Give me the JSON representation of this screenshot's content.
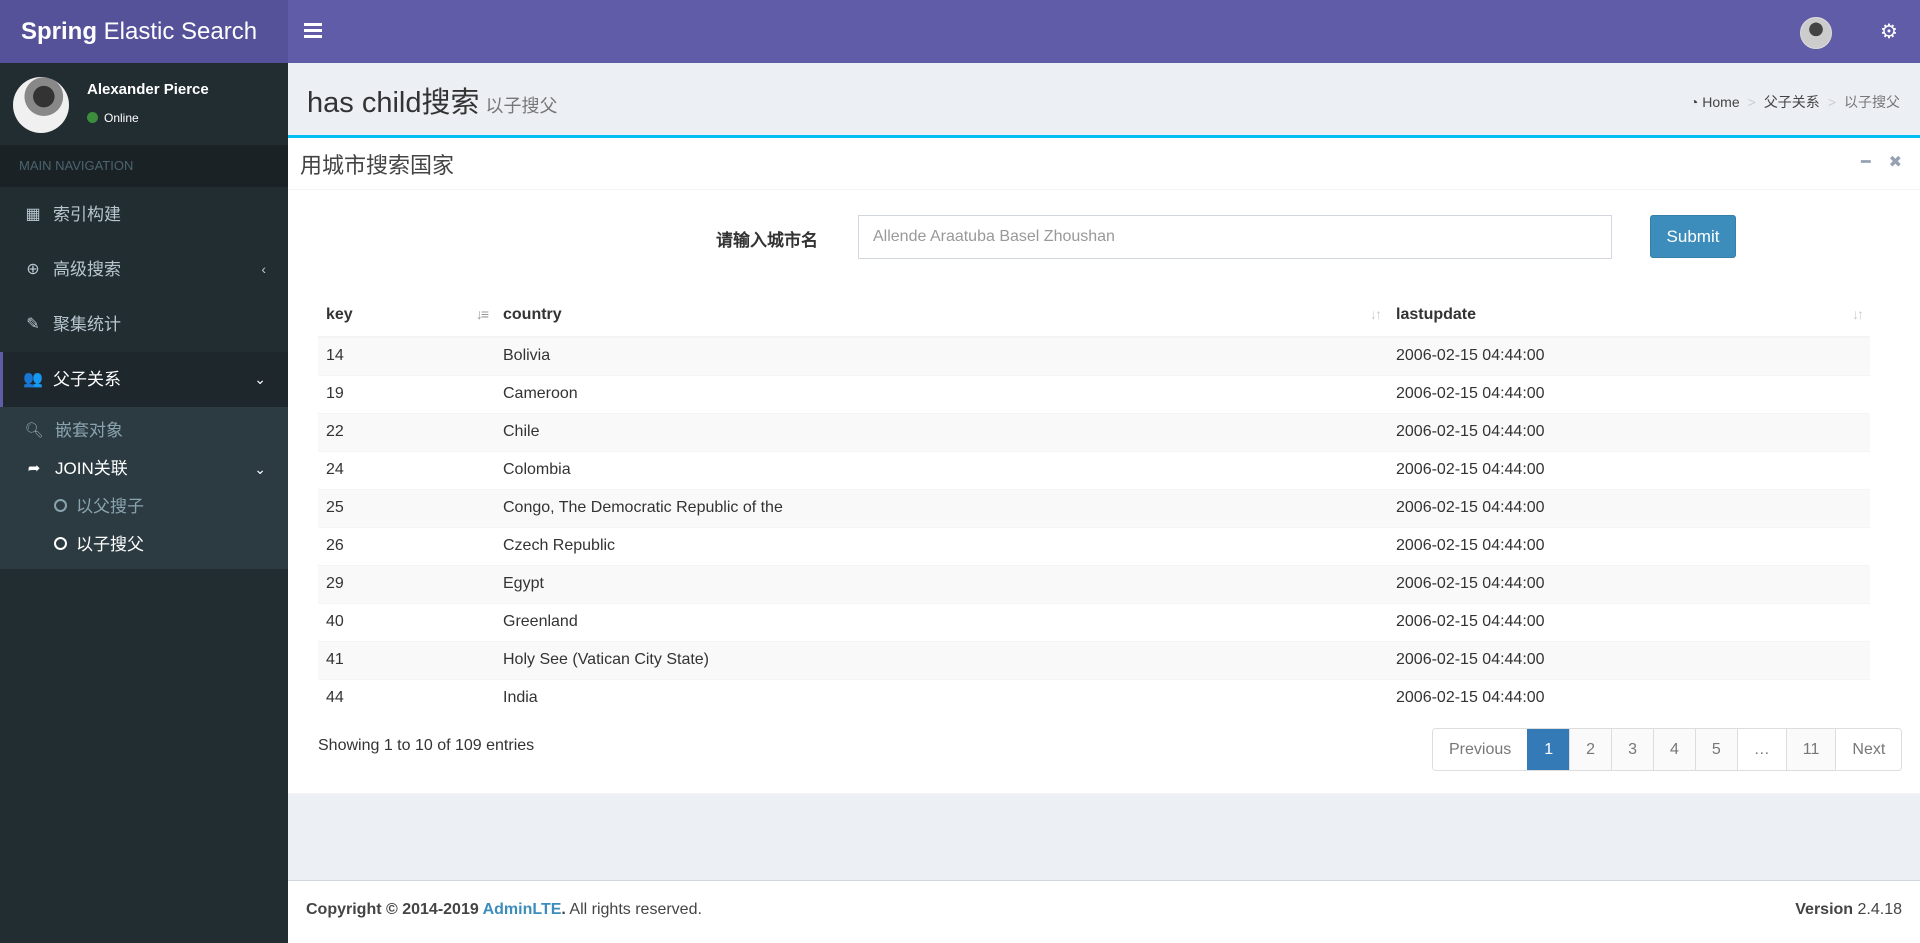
{
  "topbar": {
    "logo_bold": "Spring",
    "logo_rest": " Elastic Search",
    "menu_icon": "hamburger-icon",
    "settings_icon": "gears-icon"
  },
  "sidebar": {
    "user": {
      "name": "Alexander Pierce",
      "status": "Online",
      "status_color": "#3c8d3c"
    },
    "nav_header": "MAIN NAVIGATION",
    "items": [
      {
        "label": "索引构建",
        "icon": "calendar-icon"
      },
      {
        "label": "高级搜索",
        "icon": "search-plus-icon",
        "chevron": "‹"
      },
      {
        "label": "聚集统计",
        "icon": "edit-icon"
      },
      {
        "label": "父子关系",
        "icon": "users-icon",
        "chevron": "⌄",
        "active": true
      }
    ],
    "submenu": [
      {
        "label": "嵌套对象",
        "icon": "search-icon"
      },
      {
        "label": "JOIN关联",
        "icon": "share-icon",
        "chevron": "⌄"
      }
    ],
    "submenu2": [
      {
        "label": "以父搜子",
        "icon": "circle-icon"
      },
      {
        "label": "以子搜父",
        "icon": "circle-icon",
        "active": true
      }
    ]
  },
  "content_header": {
    "title": "has child搜索",
    "subtitle": "以子搜父",
    "breadcrumb": [
      "Home",
      "父子关系",
      "以子搜父"
    ]
  },
  "box": {
    "title": "用城市搜索国家",
    "label": "请输入城市名",
    "input_placeholder": "Allende Araatuba Basel Zhoushan",
    "input_value": "",
    "submit_label": "Submit",
    "accent": "#00c0ef"
  },
  "table": {
    "columns": [
      "key",
      "country",
      "lastupdate"
    ],
    "rows": [
      {
        "key": "14",
        "country": "Bolivia",
        "lastupdate": "2006-02-15 04:44:00"
      },
      {
        "key": "19",
        "country": "Cameroon",
        "lastupdate": "2006-02-15 04:44:00"
      },
      {
        "key": "22",
        "country": "Chile",
        "lastupdate": "2006-02-15 04:44:00"
      },
      {
        "key": "24",
        "country": "Colombia",
        "lastupdate": "2006-02-15 04:44:00"
      },
      {
        "key": "25",
        "country": "Congo, The Democratic Republic of the",
        "lastupdate": "2006-02-15 04:44:00"
      },
      {
        "key": "26",
        "country": "Czech Republic",
        "lastupdate": "2006-02-15 04:44:00"
      },
      {
        "key": "29",
        "country": "Egypt",
        "lastupdate": "2006-02-15 04:44:00"
      },
      {
        "key": "40",
        "country": "Greenland",
        "lastupdate": "2006-02-15 04:44:00"
      },
      {
        "key": "41",
        "country": "Holy See (Vatican City State)",
        "lastupdate": "2006-02-15 04:44:00"
      },
      {
        "key": "44",
        "country": "India",
        "lastupdate": "2006-02-15 04:44:00"
      }
    ],
    "info": "Showing 1 to 10 of 109 entries",
    "pagination": {
      "previous": "Previous",
      "pages": [
        "1",
        "2",
        "3",
        "4",
        "5",
        "…",
        "11"
      ],
      "current": "1",
      "next": "Next"
    }
  },
  "footer": {
    "copyright_bold": "Copyright © 2014-2019 ",
    "brand": "AdminLTE",
    "brand_suffix": ".",
    "rights": " All rights reserved.",
    "version_label": "Version",
    "version_value": " 2.4.18"
  }
}
